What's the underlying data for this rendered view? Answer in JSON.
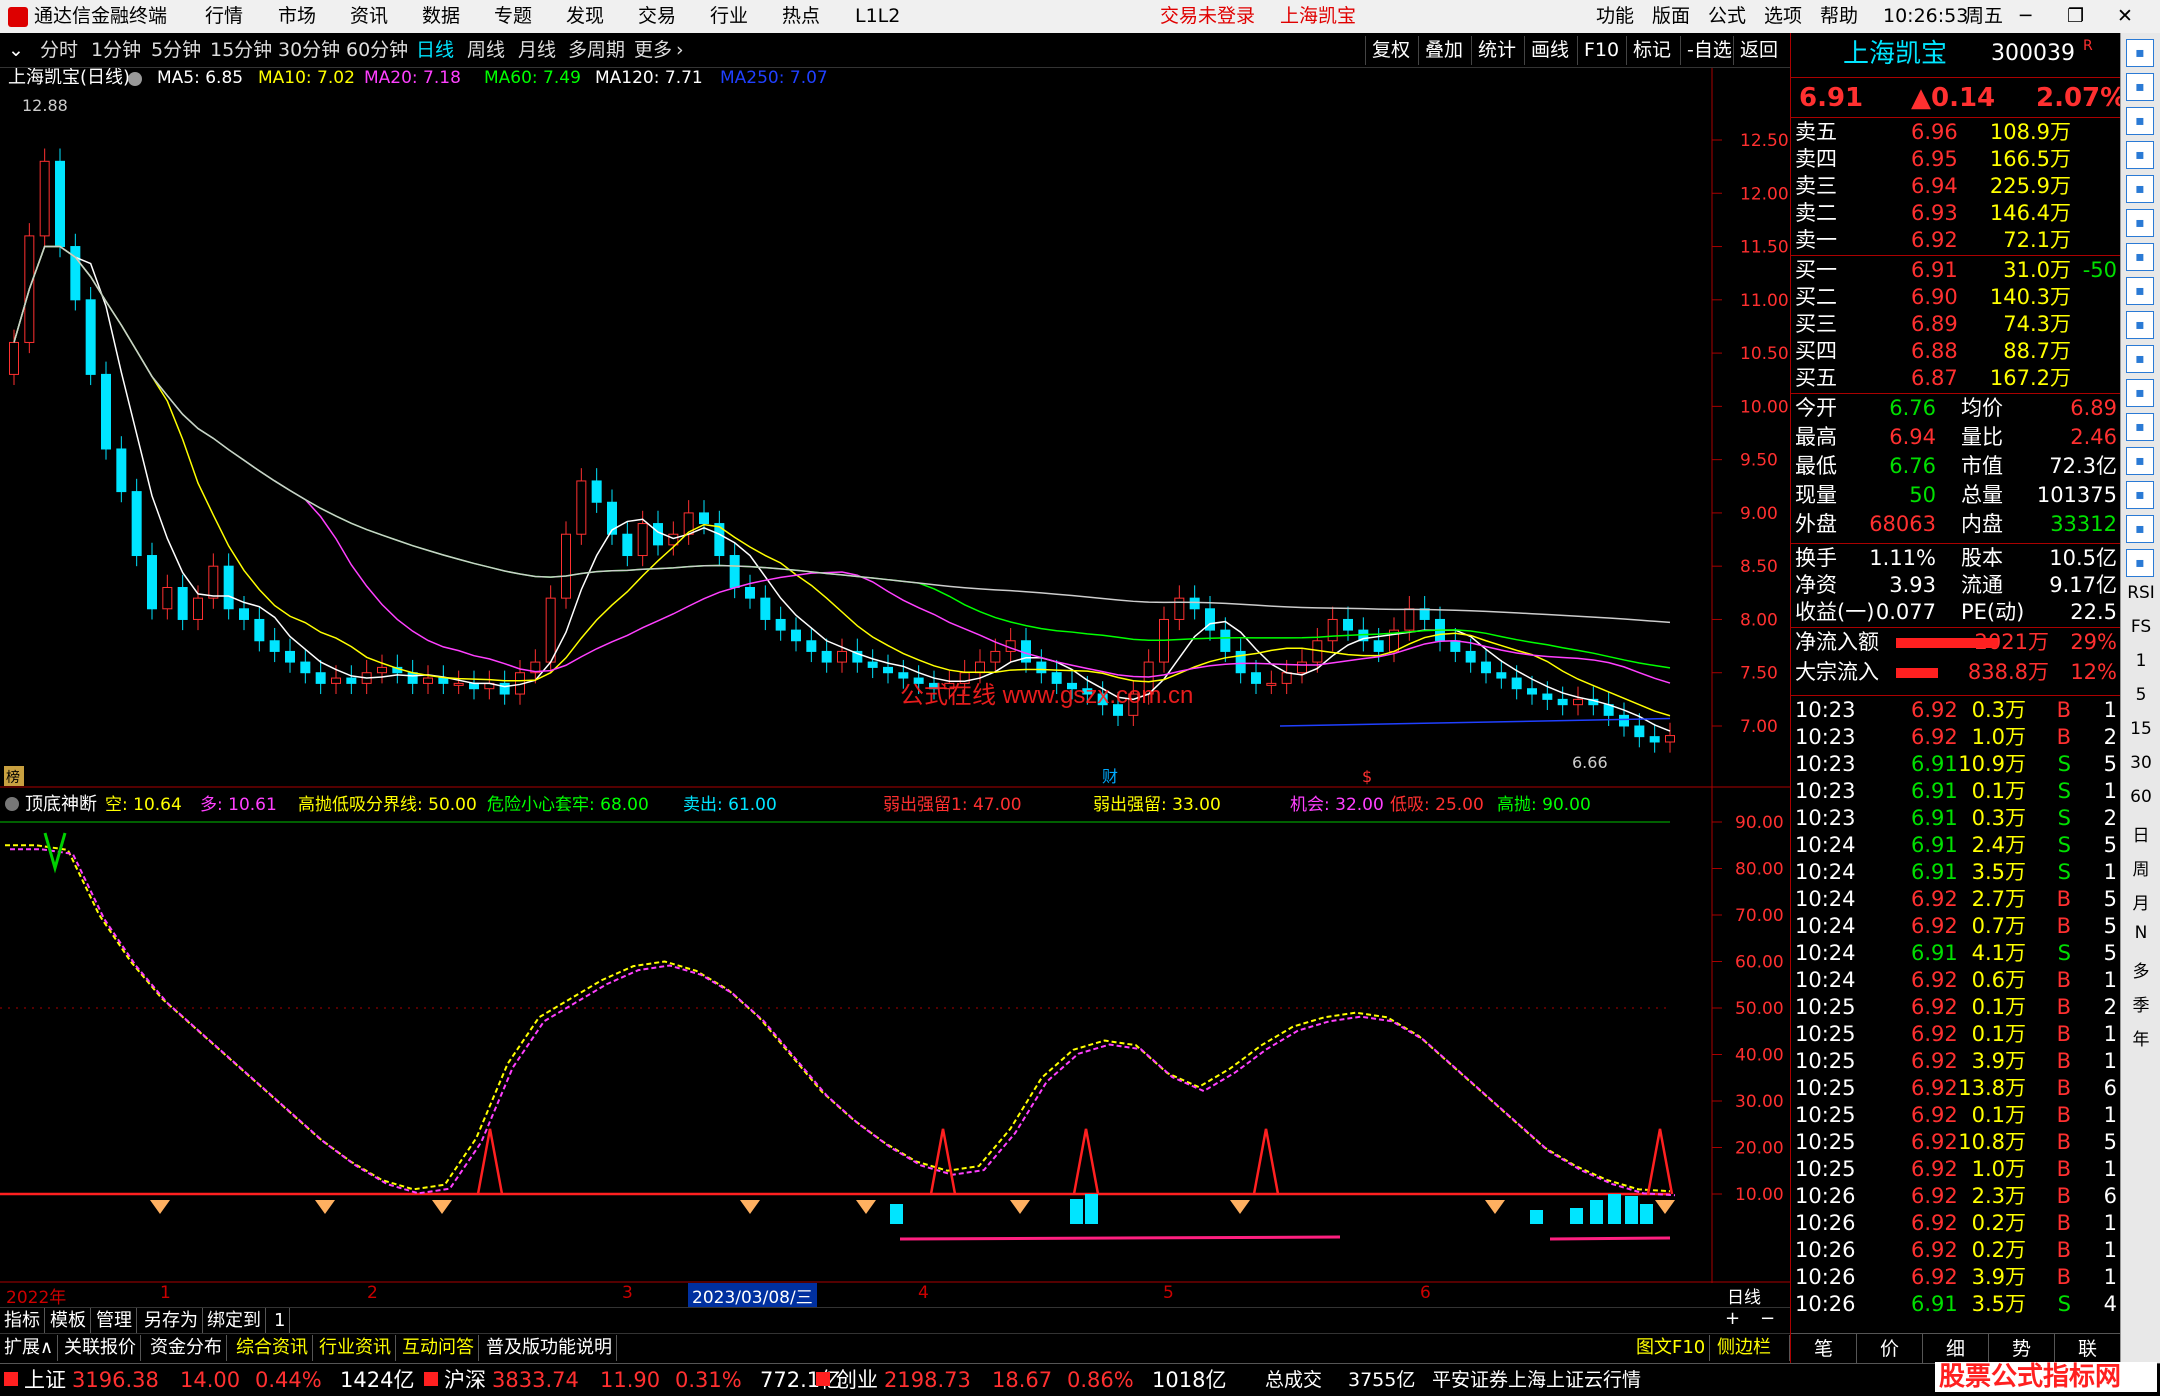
{
  "app": {
    "title": "通达信金融终端",
    "menu": [
      "行情",
      "市场",
      "资讯",
      "数据",
      "专题",
      "发现",
      "交易",
      "行业",
      "热点",
      "L1L2"
    ],
    "trade_status": "交易未登录",
    "stock_name": "上海凯宝",
    "right_menu": [
      "功能",
      "版面",
      "公式",
      "选项",
      "帮助"
    ],
    "time": "10:26:53",
    "weekday": "周五"
  },
  "toolbar": {
    "periods": [
      "分时",
      "1分钟",
      "5分钟",
      "15分钟",
      "30分钟",
      "60分钟",
      "日线",
      "周线",
      "月线",
      "多周期",
      "更多"
    ],
    "selected": "日线",
    "tools": [
      "复权",
      "叠加",
      "统计",
      "画线",
      "F10",
      "标记",
      "-自选",
      "返回"
    ]
  },
  "main_chart": {
    "title": "上海凯宝(日线)",
    "ma": [
      {
        "label": "MA5: 6.85",
        "color": "#ffffff"
      },
      {
        "label": "MA10: 7.02",
        "color": "#ffff00"
      },
      {
        "label": "MA20: 7.18",
        "color": "#ff40ff"
      },
      {
        "label": "MA60: 7.49",
        "color": "#00ff00"
      },
      {
        "label": "MA120: 7.71",
        "color": "#ffffff"
      },
      {
        "label": "MA250: 7.07",
        "color": "#2040ff"
      }
    ],
    "high_label": "12.88",
    "low_label": "6.66",
    "price_axis": [
      "12.50",
      "12.00",
      "11.50",
      "11.00",
      "10.50",
      "10.00",
      "9.50",
      "9.00",
      "8.50",
      "8.00",
      "7.50",
      "7.00"
    ],
    "markers": [
      "榜",
      "财",
      "$"
    ],
    "watermark": "公式在线 www.gszx.com.cn"
  },
  "indicator": {
    "name": "顶底神断",
    "labels": [
      {
        "text": "空: 10.64",
        "color": "#ffff00"
      },
      {
        "text": "多: 10.61",
        "color": "#ff40ff"
      },
      {
        "text": "高抛低吸分界线: 50.00",
        "color": "#ffff00"
      },
      {
        "text": "危险小心套牢: 68.00",
        "color": "#00ff00"
      },
      {
        "text": "卖出: 61.00",
        "color": "#00e5ff"
      },
      {
        "text": "弱出强留1: 47.00",
        "color": "#ff3030"
      },
      {
        "text": "弱出强留: 33.00",
        "color": "#ffff00"
      },
      {
        "text": "机会: 32.00",
        "color": "#ff40ff"
      },
      {
        "text": "低吸: 25.00",
        "color": "#ff3030"
      },
      {
        "text": "高抛: 90.00",
        "color": "#00ff00"
      }
    ],
    "axis": [
      "90.00",
      "80.00",
      "70.00",
      "60.00",
      "50.00",
      "40.00",
      "30.00",
      "20.00",
      "10.00"
    ]
  },
  "time_axis": {
    "labels": [
      "2022年",
      "1",
      "2",
      "3",
      "2023/03/08/三",
      "4",
      "5",
      "6"
    ],
    "period": "日线"
  },
  "bottom_tabs": {
    "row1": [
      "指标",
      "模板",
      "管理",
      "另存为",
      "绑定到",
      "1"
    ],
    "row2": [
      "扩展∧",
      "关联报价",
      "资金分布",
      "综合资讯",
      "行业资讯",
      "互动问答",
      "普及版功能说明"
    ],
    "right": [
      "图文F10",
      "侧边栏《"
    ]
  },
  "quote": {
    "name": "上海凯宝",
    "code": "300039",
    "price": "6.91",
    "change": "▲0.14",
    "pct": "2.07%",
    "asks": [
      {
        "label": "卖五",
        "price": "6.96",
        "vol": "108.9万"
      },
      {
        "label": "卖四",
        "price": "6.95",
        "vol": "166.5万"
      },
      {
        "label": "卖三",
        "price": "6.94",
        "vol": "225.9万"
      },
      {
        "label": "卖二",
        "price": "6.93",
        "vol": "146.4万"
      },
      {
        "label": "卖一",
        "price": "6.92",
        "vol": "72.1万"
      }
    ],
    "bids": [
      {
        "label": "买一",
        "price": "6.91",
        "vol": "31.0万",
        "diff": "-50"
      },
      {
        "label": "买二",
        "price": "6.90",
        "vol": "140.3万",
        "diff": ""
      },
      {
        "label": "买三",
        "price": "6.89",
        "vol": "74.3万",
        "diff": ""
      },
      {
        "label": "买四",
        "price": "6.88",
        "vol": "88.7万",
        "diff": ""
      },
      {
        "label": "买五",
        "price": "6.87",
        "vol": "167.2万",
        "diff": ""
      }
    ],
    "stats": [
      {
        "l1": "今开",
        "v1": "6.76",
        "c1": "g",
        "l2": "均价",
        "v2": "6.89",
        "c2": "r"
      },
      {
        "l1": "最高",
        "v1": "6.94",
        "c1": "r",
        "l2": "量比",
        "v2": "2.46",
        "c2": "r"
      },
      {
        "l1": "最低",
        "v1": "6.76",
        "c1": "g",
        "l2": "市值",
        "v2": "72.3亿",
        "c2": "w"
      },
      {
        "l1": "现量",
        "v1": "50",
        "c1": "g",
        "l2": "总量",
        "v2": "101375",
        "c2": "w"
      },
      {
        "l1": "外盘",
        "v1": "68063",
        "c1": "r",
        "l2": "内盘",
        "v2": "33312",
        "c2": "g"
      }
    ],
    "fin": [
      {
        "l1": "换手",
        "v1": "1.11%",
        "l2": "股本",
        "v2": "10.5亿"
      },
      {
        "l1": "净资",
        "v1": "3.93",
        "l2": "流通",
        "v2": "9.17亿"
      },
      {
        "l1": "收益(一)",
        "v1": "0.077",
        "l2": "PE(动)",
        "v2": "22.5"
      }
    ],
    "flows": [
      {
        "label": "净流入额",
        "value": "2021万",
        "pct": "29%",
        "fill": 0.29
      },
      {
        "label": "大宗流入",
        "value": "838.8万",
        "pct": "12%",
        "fill": 0.12
      }
    ],
    "ticks": [
      {
        "t": "10:23",
        "p": "6.92",
        "v": "0.3万",
        "bs": "B",
        "n": "1"
      },
      {
        "t": "10:23",
        "p": "6.92",
        "v": "1.0万",
        "bs": "B",
        "n": "2"
      },
      {
        "t": "10:23",
        "p": "6.91",
        "v": "10.9万",
        "bs": "S",
        "n": "5"
      },
      {
        "t": "10:23",
        "p": "6.91",
        "v": "0.1万",
        "bs": "S",
        "n": "1"
      },
      {
        "t": "10:23",
        "p": "6.91",
        "v": "0.3万",
        "bs": "S",
        "n": "2"
      },
      {
        "t": "10:24",
        "p": "6.91",
        "v": "2.4万",
        "bs": "S",
        "n": "5"
      },
      {
        "t": "10:24",
        "p": "6.91",
        "v": "3.5万",
        "bs": "S",
        "n": "1"
      },
      {
        "t": "10:24",
        "p": "6.92",
        "v": "2.7万",
        "bs": "B",
        "n": "5"
      },
      {
        "t": "10:24",
        "p": "6.92",
        "v": "0.7万",
        "bs": "B",
        "n": "5"
      },
      {
        "t": "10:24",
        "p": "6.91",
        "v": "4.1万",
        "bs": "S",
        "n": "5"
      },
      {
        "t": "10:24",
        "p": "6.92",
        "v": "0.6万",
        "bs": "B",
        "n": "1"
      },
      {
        "t": "10:25",
        "p": "6.92",
        "v": "0.1万",
        "bs": "B",
        "n": "2"
      },
      {
        "t": "10:25",
        "p": "6.92",
        "v": "0.1万",
        "bs": "B",
        "n": "1"
      },
      {
        "t": "10:25",
        "p": "6.92",
        "v": "3.9万",
        "bs": "B",
        "n": "1"
      },
      {
        "t": "10:25",
        "p": "6.92",
        "v": "13.8万",
        "bs": "B",
        "n": "6"
      },
      {
        "t": "10:25",
        "p": "6.92",
        "v": "0.1万",
        "bs": "B",
        "n": "1"
      },
      {
        "t": "10:25",
        "p": "6.92",
        "v": "10.8万",
        "bs": "B",
        "n": "5"
      },
      {
        "t": "10:25",
        "p": "6.92",
        "v": "1.0万",
        "bs": "B",
        "n": "1"
      },
      {
        "t": "10:26",
        "p": "6.92",
        "v": "2.3万",
        "bs": "B",
        "n": "6"
      },
      {
        "t": "10:26",
        "p": "6.92",
        "v": "0.2万",
        "bs": "B",
        "n": "1"
      },
      {
        "t": "10:26",
        "p": "6.92",
        "v": "0.2万",
        "bs": "B",
        "n": "1"
      },
      {
        "t": "10:26",
        "p": "6.92",
        "v": "3.9万",
        "bs": "B",
        "n": "1"
      },
      {
        "t": "10:26",
        "p": "6.91",
        "v": "3.5万",
        "bs": "S",
        "n": "4"
      }
    ],
    "tabs": [
      "笔",
      "价",
      "细",
      "势",
      "联"
    ]
  },
  "sidebar_right": {
    "labels": [
      "RSI",
      "FS",
      "1",
      "5",
      "15",
      "30",
      "60",
      "日",
      "周",
      "月",
      "N",
      "多",
      "季",
      "年"
    ]
  },
  "status": {
    "indices": [
      {
        "name": "上证",
        "value": "3196.38",
        "chg": "14.00",
        "pct": "0.44%",
        "amt": "1424亿"
      },
      {
        "name": "沪深",
        "value": "3833.74",
        "chg": "11.90",
        "pct": "0.31%",
        "amt": "772.1亿"
      },
      {
        "name": "创业",
        "value": "2198.73",
        "chg": "18.67",
        "pct": "0.86%",
        "amt": "1018亿"
      }
    ],
    "total_label": "总成交",
    "total": "3755亿",
    "server": "平安证券上海上证云行情",
    "watermark": "股票公式指标网",
    "watermark_url": "www.gszx.com.cn"
  }
}
